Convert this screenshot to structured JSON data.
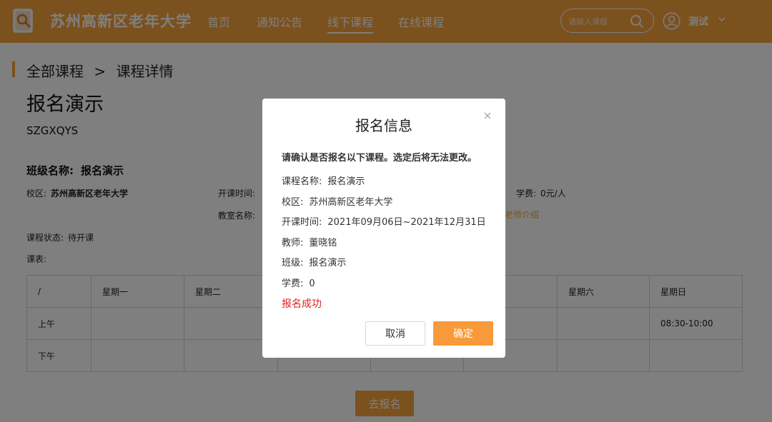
{
  "colors": {
    "accent": "#f7a23c",
    "success_text": "#e02020",
    "link": "#f7a23c"
  },
  "header": {
    "brand": "苏州高新区老年大学",
    "nav": [
      {
        "label": "首页"
      },
      {
        "label": "通知公告"
      },
      {
        "label": "线下课程"
      },
      {
        "label": "在线课程"
      }
    ],
    "active_nav": "线下课程",
    "search": {
      "placeholder": "请输入课程",
      "icon": "search-icon"
    },
    "user": {
      "name": "测试",
      "icon": "avatar-icon"
    }
  },
  "breadcrumb": {
    "root": "全部课程",
    "separator": ">",
    "current": "课程详情"
  },
  "course": {
    "title": "报名演示",
    "code": "SZGXQYS",
    "class_label": "班级名称:",
    "class_value": "报名演示",
    "campus_label": "校区:",
    "campus_value": "苏州高新区老年大学",
    "start_label": "开课时间:",
    "classroom_label": "教室名称:",
    "fee_label": "学费:",
    "fee_value": "0元/人",
    "teacher_intro_link": "老师介绍",
    "status_label": "课程状态:",
    "status_value": "待开课",
    "schedule_label": "课表:"
  },
  "schedule": {
    "headers": [
      "/",
      "星期一",
      "星期二",
      "",
      "",
      "",
      "星期六",
      "星期日"
    ],
    "rows": [
      {
        "label": "上午",
        "cells": [
          "",
          "",
          "",
          "",
          "",
          "",
          "08:30-10:00"
        ]
      },
      {
        "label": "下午",
        "cells": [
          "",
          "",
          "",
          "",
          "",
          "",
          ""
        ]
      }
    ]
  },
  "enroll_button": "去报名",
  "modal": {
    "title": "报名信息",
    "warning": "请确认是否报名以下课程。选定后将无法更改。",
    "rows": [
      {
        "label": "课程名称:",
        "value": "报名演示"
      },
      {
        "label": "校区:",
        "value": "苏州高新区老年大学"
      },
      {
        "label": "开课时间:",
        "value": "2021年09月06日~2021年12月31日"
      },
      {
        "label": "教师:",
        "value": "董晓铭"
      },
      {
        "label": "班级:",
        "value": "报名演示"
      },
      {
        "label": "学费:",
        "value": "0"
      }
    ],
    "success": "报名成功",
    "cancel": "取消",
    "confirm": "确定"
  }
}
